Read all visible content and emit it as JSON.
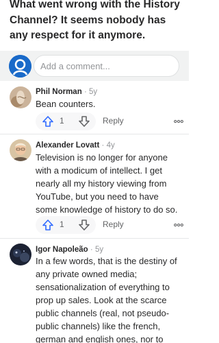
{
  "question": {
    "title": "What went wrong with the History Channel? It seems nobody has any respect for it anymore."
  },
  "compose": {
    "placeholder": "Add a comment..."
  },
  "comments": [
    {
      "author": "Phil Norman",
      "separator": "·",
      "age": "5y",
      "text": "Bean counters.",
      "upvotes": "1",
      "reply_label": "Reply"
    },
    {
      "author": "Alexander Lovatt",
      "separator": "·",
      "age": "4y",
      "text": "Television is no longer for anyone with a modicum of intellect. I get nearly all my history viewing from YouTube, but you need to have some knowledge of history to do so.",
      "upvotes": "1",
      "reply_label": "Reply"
    },
    {
      "author": "Igor Napoleão",
      "separator": "·",
      "age": "5y",
      "text": "In a few words, that is the destiny of any private owned media; sensationalization of everything to prop up sales. Look at the scarce public channels (real, not pseudo-public channels) like the french, german and english ones, nor to"
    }
  ],
  "icons": {
    "compose_avatar": "default-profile-icon",
    "upvote": "upvote-arrow-icon",
    "downvote": "downvote-arrow-icon",
    "more": "more-options-icon"
  },
  "colors": {
    "accent_blue": "#2e69ff",
    "text": "#282829",
    "muted": "#939598",
    "compose_bar_bg": "#f1f2f2",
    "profile_blue": "#1a6ac9"
  }
}
